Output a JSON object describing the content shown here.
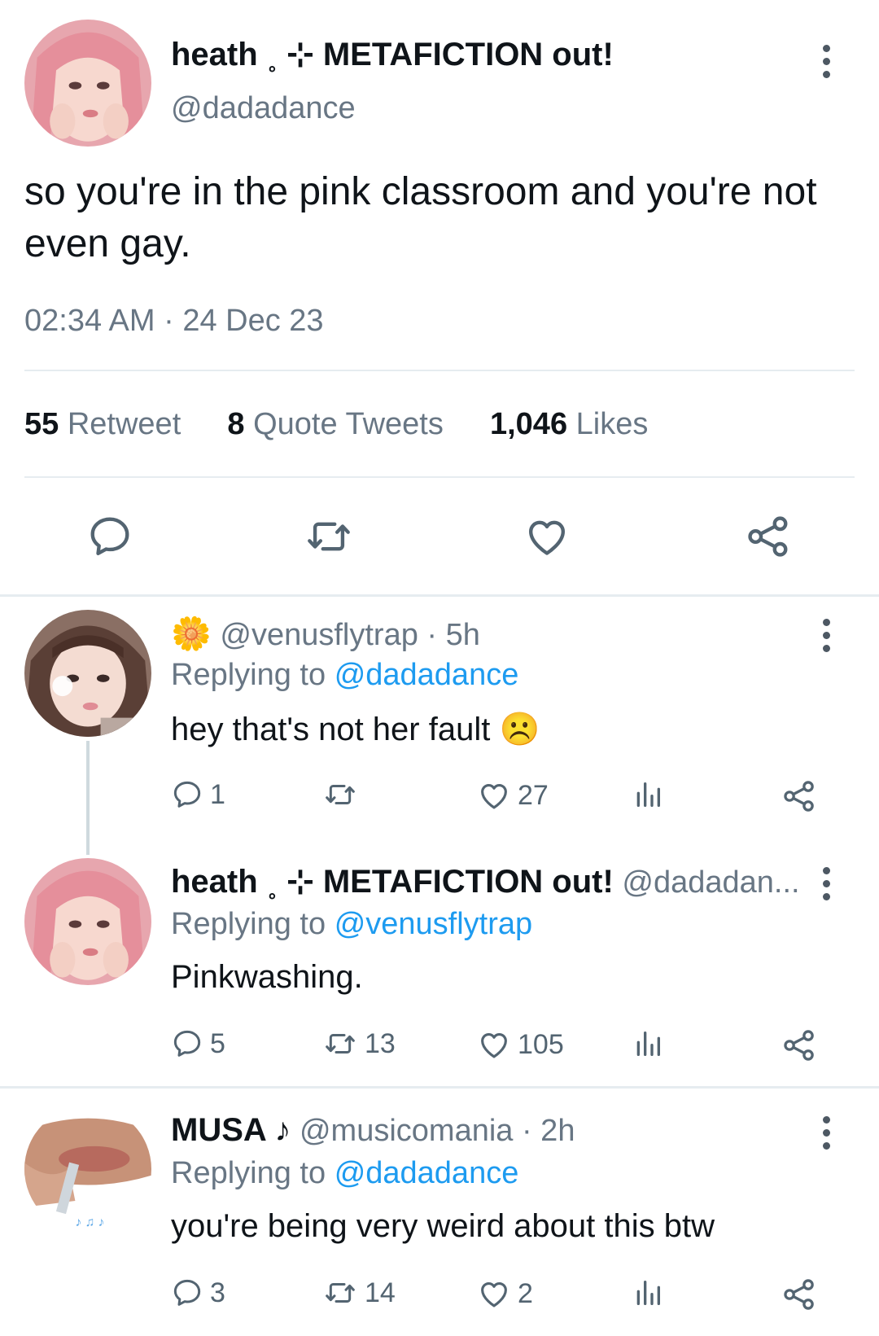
{
  "main_tweet": {
    "author_name": "heath ˳ ⊹ METAFICTION out!",
    "author_handle": "@dadadance",
    "text": "so you're in the pink classroom and you're not even gay.",
    "timestamp": "02:34 AM · 24 Dec 23",
    "stats": {
      "retweets_count": "55",
      "retweets_label": "Retweet",
      "quotes_count": "8",
      "quotes_label": "Quote Tweets",
      "likes_count": "1,046",
      "likes_label": "Likes"
    },
    "actions": [
      "reply-icon",
      "retweet-icon",
      "like-icon",
      "share-icon"
    ]
  },
  "replies": [
    {
      "name": "",
      "name_emoji": "🌼",
      "handle": "@venusflytrap",
      "time": "· 5h",
      "replying_prefix": "Replying to",
      "replying_to": "@dadadance",
      "text": "hey that's not her fault",
      "text_emoji": "☹️",
      "reply_count": "1",
      "retweet_count": "",
      "like_count": "27"
    },
    {
      "name": "heath ˳ ⊹ METAFICTION out!",
      "handle": "@dadadan...",
      "time": "",
      "replying_prefix": "Replying to",
      "replying_to": "@venusflytrap",
      "text": "Pinkwashing.",
      "reply_count": "5",
      "retweet_count": "13",
      "like_count": "105"
    },
    {
      "name": "MUSA ♪",
      "handle": "@musicomania",
      "time": "· 2h",
      "replying_prefix": "Replying to",
      "replying_to": "@dadadance",
      "text": "you're being very weird about this btw",
      "reply_count": "3",
      "retweet_count": "14",
      "like_count": "2"
    }
  ],
  "colors": {
    "text": "#0f1419",
    "secondary": "#687684",
    "link": "#1d9bf0",
    "divider": "#e6ecf0",
    "icon": "#536471"
  }
}
